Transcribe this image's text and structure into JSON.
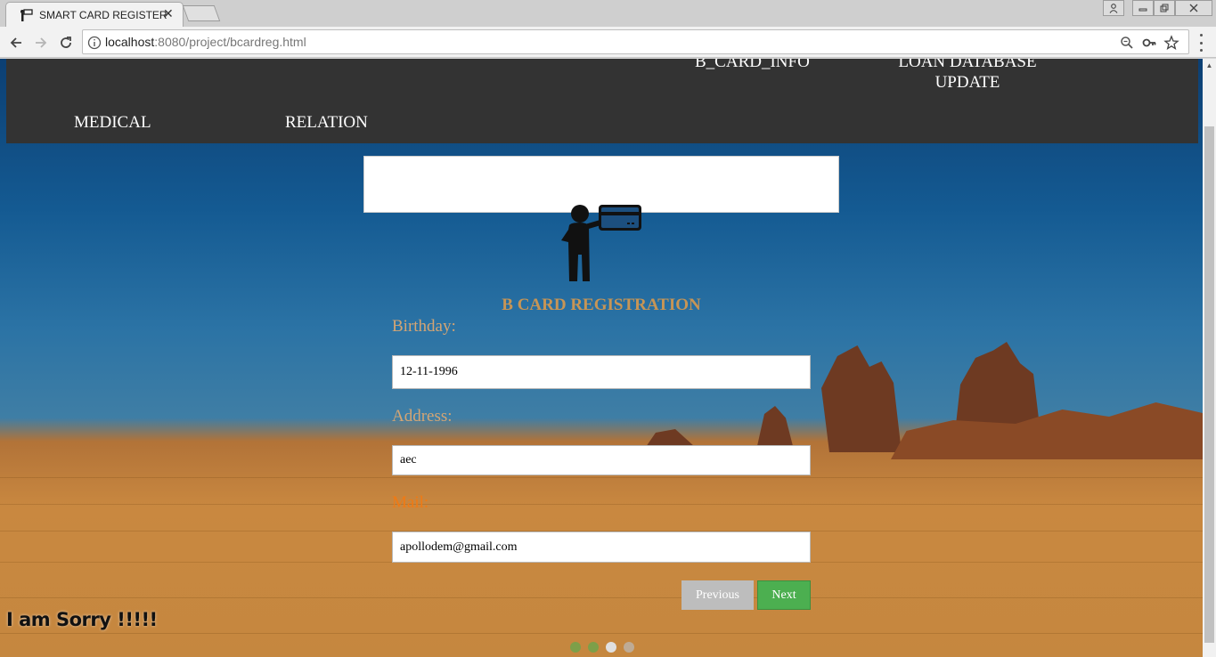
{
  "browser": {
    "tab_title": "SMART CARD REGISTER",
    "url_host": "localhost",
    "url_rest": ":8080/project/bcardreg.html"
  },
  "nav": {
    "items": {
      "b_card_info": "B_CARD_INFO",
      "loan_line1": "LOAN DATABASE",
      "loan_line2": "UPDATE",
      "medical": "MEDICAL",
      "relation": "RELATION"
    }
  },
  "form": {
    "title": "B CARD REGISTRATION",
    "birthday_label": "Birthday:",
    "birthday_value": "12-11-1996",
    "address_label": "Address:",
    "address_value": "aec",
    "mail_label": "Mail:",
    "mail_value": "apollodem@gmail.com",
    "previous_label": "Previous",
    "next_label": "Next"
  },
  "sorry_text": "I am Sorry !!!!!",
  "steps": {
    "current": 3,
    "total": 4
  },
  "colors": {
    "navbar_bg": "#333333",
    "label_tan": "#d4a574",
    "label_orange": "#f07a14",
    "next_green": "#4caf50",
    "prev_gray": "#bdbdbd",
    "step_done": "#4caf50",
    "step_current": "#e0e0e0",
    "step_pending": "#bbbbbb"
  }
}
